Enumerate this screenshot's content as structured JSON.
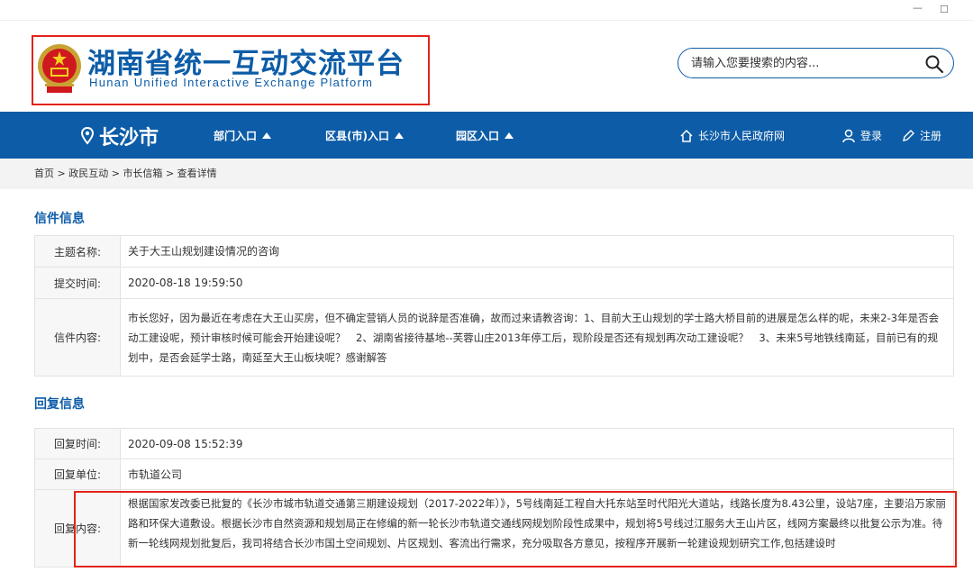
{
  "window": {
    "minimize_glyph": "—",
    "maximize_glyph": "☐"
  },
  "header": {
    "title_cn": "湖南省统一互动交流平台",
    "title_en": "Hunan Unified Interactive Exchange Platform",
    "search_placeholder": "请输入您要搜索的内容...",
    "icons": {
      "emblem": "national-emblem-icon",
      "search": "search-icon"
    }
  },
  "nav": {
    "city": "长沙市",
    "items": [
      {
        "label": "部门入口"
      },
      {
        "label": "区县(市)入口"
      },
      {
        "label": "园区入口"
      }
    ],
    "gov_site": "长沙市人民政府网",
    "login": "登录",
    "register": "注册",
    "colors": {
      "nav_bg": "#0d5ca7",
      "accent": "#0d5ca7",
      "highlight_border": "#e2231a"
    }
  },
  "breadcrumb": {
    "items": [
      "首页",
      "政民互动",
      "市长信箱",
      "查看详情"
    ],
    "separator": ">"
  },
  "letter": {
    "section_title": "信件信息",
    "rows": [
      {
        "label": "主题名称:",
        "value": "关于大王山规划建设情况的咨询"
      },
      {
        "label": "提交时间:",
        "value": "2020-08-18 19:59:50"
      },
      {
        "label": "信件内容:",
        "value": "市长您好，因为最近在考虑在大王山买房，但不确定营销人员的说辞是否准确，故而过来请教咨询：1、目前大王山规划的学士路大桥目前的进展是怎么样的呢，未来2-3年是否会动工建设呢，预计审核时候可能会开始建设呢？　2、湖南省接待基地--芙蓉山庄2013年停工后，现阶段是否还有规划再次动工建设呢？　3、未来5号地铁线南延，目前已有的规划中，是否会延学士路，南延至大王山板块呢？感谢解答"
      }
    ]
  },
  "reply": {
    "section_title": "回复信息",
    "rows": [
      {
        "label": "回复时间:",
        "value": "2020-09-08 15:52:39"
      },
      {
        "label": "回复单位:",
        "value": "市轨道公司"
      },
      {
        "label": "回复内容:",
        "value": "根据国家发改委已批复的《长沙市城市轨道交通第三期建设规划（2017-2022年）》，5号线南延工程自大托东站至时代阳光大道站，线路长度为8.43公里，设站7座，主要沿万家丽路和环保大道敷设。根据长沙市自然资源和规划局正在修编的新一轮长沙市轨道交通线网规划阶段性成果中，规划将5号线过江服务大王山片区，线网方案最终以批复公示为准。待新一轮线网规划批复后，我司将结合长沙市国土空间规划、片区规划、客流出行需求，充分吸取各方意见，按程序开展新一轮建设规划研究工作,包括建设时"
      }
    ]
  }
}
